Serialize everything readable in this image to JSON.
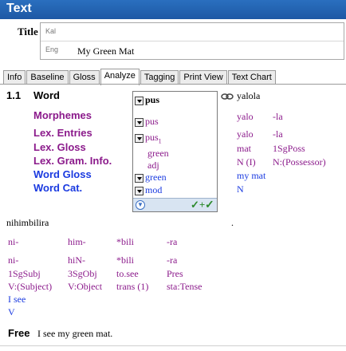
{
  "window": {
    "title": "Text"
  },
  "title_field": {
    "label": "Title",
    "rows": [
      {
        "ws": "Kal",
        "value": ""
      },
      {
        "ws": "Eng",
        "value": "My Green Mat"
      }
    ]
  },
  "tabs": [
    {
      "label": "Info",
      "active": false
    },
    {
      "label": "Baseline",
      "active": false
    },
    {
      "label": "Gloss",
      "active": false
    },
    {
      "label": "Analyze",
      "active": true
    },
    {
      "label": "Tagging",
      "active": false
    },
    {
      "label": "Print View",
      "active": false
    },
    {
      "label": "Text Chart",
      "active": false
    }
  ],
  "segment": {
    "number": "1.1",
    "word_label": "Word",
    "row_labels": {
      "morphemes": "Morphemes",
      "lex_entries": "Lex. Entries",
      "lex_gloss": "Lex. Gloss",
      "lex_gram_info": "Lex. Gram. Info.",
      "word_gloss": "Word Gloss",
      "word_cat": "Word Cat."
    },
    "popup": {
      "word": "pus",
      "morpheme": "pus",
      "entry": "pus",
      "entry_sub": "1",
      "gloss": "green",
      "gram": "adj",
      "word_gloss": "green",
      "word_cat": "mod"
    },
    "next_word": {
      "word": "yalola",
      "morphemes": [
        "yalo",
        "-la"
      ],
      "entries": [
        "yalo",
        "-la"
      ],
      "gloss": [
        "mat",
        "1SgPoss"
      ],
      "gram": [
        "N (I)",
        "N:(Possessor)"
      ],
      "word_gloss": "my mat",
      "word_cat": "N"
    },
    "period": "."
  },
  "analysis2": {
    "word": "nihimbilira",
    "morphemes": [
      "ni-",
      "him-",
      "*bili",
      "-ra"
    ],
    "entries": [
      "ni-",
      "hiN-",
      "*bili",
      "-ra"
    ],
    "gloss": [
      "1SgSubj",
      "3SgObj",
      "to.see",
      "Pres"
    ],
    "gram": [
      "V:(Subject)",
      "V:Object",
      "trans (1)",
      "sta:Tense"
    ],
    "word_gloss": "I see",
    "word_cat": "V"
  },
  "free": {
    "label": "Free",
    "value": "I see my green mat."
  },
  "colors": {
    "titlebar": "#2a6fbf",
    "purple": "#8b1a8b",
    "blue": "#1a3ae0",
    "green": "#2c8a2c"
  }
}
